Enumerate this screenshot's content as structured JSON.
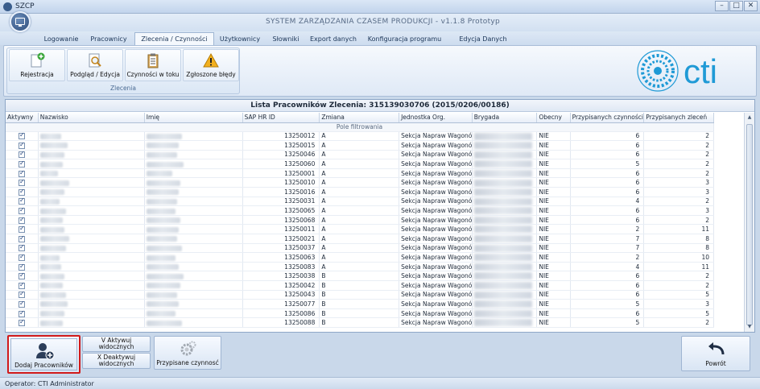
{
  "window": {
    "app_title": "SZCP",
    "system_title": "SYSTEM  ZARZĄDZANIA CZASEM PRODUKCJI   -  v1.1.8 Prototyp"
  },
  "tabs": [
    "Logowanie",
    "Pracownicy",
    "Zlecenia / Czynności",
    "Użytkownicy",
    "Słowniki",
    "Export danych",
    "Konfiguracja programu",
    "Edycja Danych"
  ],
  "ribbon": {
    "group_name": "Zlecenia",
    "buttons": [
      "Rejestracja",
      "Podgląd / Edycja",
      "Czynności w toku",
      "Zgłoszone błędy"
    ]
  },
  "logo_text": "cti",
  "list": {
    "title": "Lista Pracowników Zlecenia: 315139030706 (2015/0206/00186)",
    "columns": [
      "Aktywny",
      "Nazwisko",
      "Imię",
      "SAP HR ID",
      "Zmiana",
      "Jednostka Org.",
      "Brygada",
      "Obecny",
      "Przypisanych czynności",
      "Przypisanych zleceń"
    ],
    "filter_label": "Pole filtrowania",
    "rows": [
      {
        "sap": "13250012",
        "zmiana": "A",
        "jednostka": "Sekcja Napraw Wagonów",
        "obecny": "NIE",
        "czynnosci": "6",
        "zlecen": "2"
      },
      {
        "sap": "13250015",
        "zmiana": "A",
        "jednostka": "Sekcja Napraw Wagonów",
        "obecny": "NIE",
        "czynnosci": "6",
        "zlecen": "2"
      },
      {
        "sap": "13250046",
        "zmiana": "A",
        "jednostka": "Sekcja Napraw Wagonów",
        "obecny": "NIE",
        "czynnosci": "6",
        "zlecen": "2"
      },
      {
        "sap": "13250060",
        "zmiana": "A",
        "jednostka": "Sekcja Napraw Wagonów",
        "obecny": "NIE",
        "czynnosci": "5",
        "zlecen": "2"
      },
      {
        "sap": "13250001",
        "zmiana": "A",
        "jednostka": "Sekcja Napraw Wagonów",
        "obecny": "NIE",
        "czynnosci": "6",
        "zlecen": "2"
      },
      {
        "sap": "13250010",
        "zmiana": "A",
        "jednostka": "Sekcja Napraw Wagonów",
        "obecny": "NIE",
        "czynnosci": "6",
        "zlecen": "3"
      },
      {
        "sap": "13250016",
        "zmiana": "A",
        "jednostka": "Sekcja Napraw Wagonów",
        "obecny": "NIE",
        "czynnosci": "6",
        "zlecen": "3"
      },
      {
        "sap": "13250031",
        "zmiana": "A",
        "jednostka": "Sekcja Napraw Wagonów",
        "obecny": "NIE",
        "czynnosci": "4",
        "zlecen": "2"
      },
      {
        "sap": "13250065",
        "zmiana": "A",
        "jednostka": "Sekcja Napraw Wagonów",
        "obecny": "NIE",
        "czynnosci": "6",
        "zlecen": "3"
      },
      {
        "sap": "13250068",
        "zmiana": "A",
        "jednostka": "Sekcja Napraw Wagonów",
        "obecny": "NIE",
        "czynnosci": "6",
        "zlecen": "2"
      },
      {
        "sap": "13250011",
        "zmiana": "A",
        "jednostka": "Sekcja Napraw Wagonów",
        "obecny": "NIE",
        "czynnosci": "2",
        "zlecen": "11"
      },
      {
        "sap": "13250021",
        "zmiana": "A",
        "jednostka": "Sekcja Napraw Wagonów",
        "obecny": "NIE",
        "czynnosci": "7",
        "zlecen": "8"
      },
      {
        "sap": "13250037",
        "zmiana": "A",
        "jednostka": "Sekcja Napraw Wagonów",
        "obecny": "NIE",
        "czynnosci": "7",
        "zlecen": "8"
      },
      {
        "sap": "13250063",
        "zmiana": "A",
        "jednostka": "Sekcja Napraw Wagonów",
        "obecny": "NIE",
        "czynnosci": "2",
        "zlecen": "10"
      },
      {
        "sap": "13250083",
        "zmiana": "A",
        "jednostka": "Sekcja Napraw Wagonów",
        "obecny": "NIE",
        "czynnosci": "4",
        "zlecen": "11"
      },
      {
        "sap": "13250038",
        "zmiana": "B",
        "jednostka": "Sekcja Napraw Wagonów",
        "obecny": "NIE",
        "czynnosci": "6",
        "zlecen": "2"
      },
      {
        "sap": "13250042",
        "zmiana": "B",
        "jednostka": "Sekcja Napraw Wagonów",
        "obecny": "NIE",
        "czynnosci": "6",
        "zlecen": "2"
      },
      {
        "sap": "13250043",
        "zmiana": "B",
        "jednostka": "Sekcja Napraw Wagonów",
        "obecny": "NIE",
        "czynnosci": "6",
        "zlecen": "5"
      },
      {
        "sap": "13250077",
        "zmiana": "B",
        "jednostka": "Sekcja Napraw Wagonów",
        "obecny": "NIE",
        "czynnosci": "5",
        "zlecen": "3"
      },
      {
        "sap": "13250086",
        "zmiana": "B",
        "jednostka": "Sekcja Napraw Wagonów",
        "obecny": "NIE",
        "czynnosci": "6",
        "zlecen": "5"
      },
      {
        "sap": "13250088",
        "zmiana": "B",
        "jednostka": "Sekcja Napraw Wagonów",
        "obecny": "NIE",
        "czynnosci": "5",
        "zlecen": "2"
      }
    ]
  },
  "bottom": {
    "add_label": "Dodaj Pracowników",
    "activate_label": "V Aktywuj widocznych",
    "deactivate_label": "X Deaktywuj widocznych",
    "assigned_label": "Przypisane czynnosć",
    "back_label": "Powrót"
  },
  "status": {
    "operator": "Operator: CTI Administrator"
  },
  "colors": {
    "accent": "#2b4a78",
    "highlight_border": "#d11a1a",
    "warning": "#f2b01e",
    "add": "#3aa63a"
  }
}
